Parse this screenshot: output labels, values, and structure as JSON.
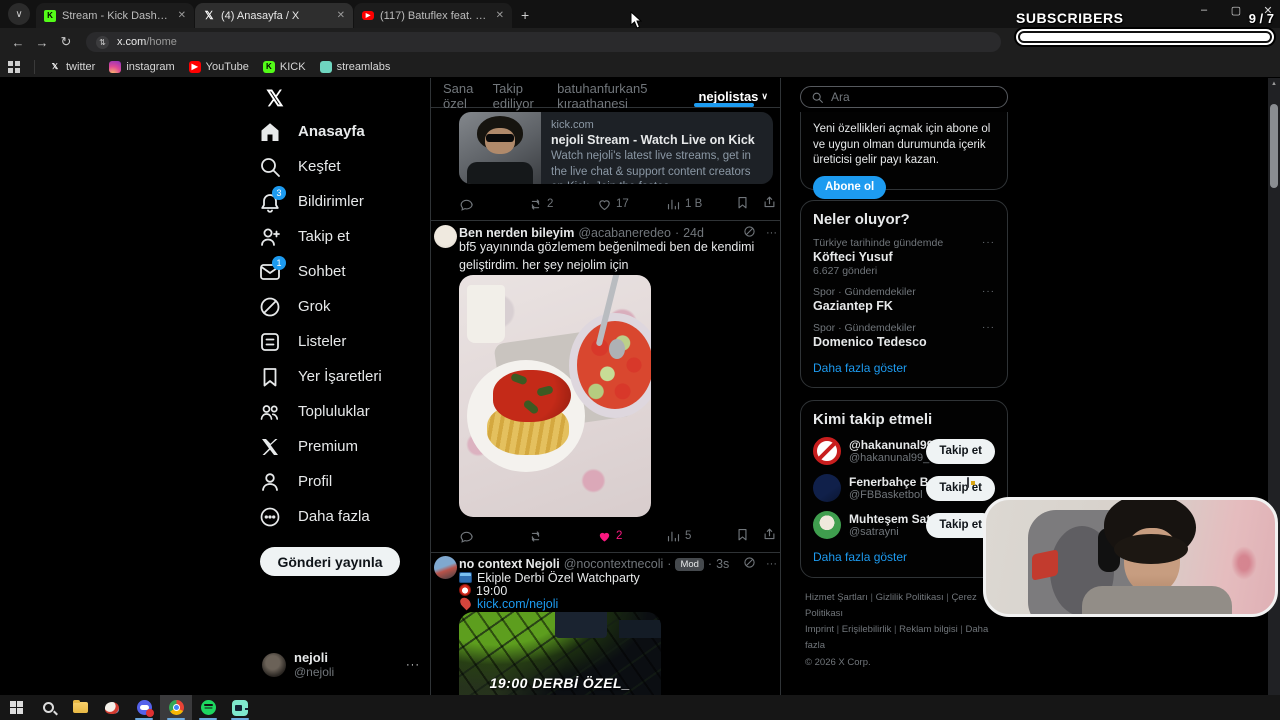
{
  "ui": {
    "sep": "·",
    "close": "✕",
    "plus": "+",
    "more": "···",
    "chevron_down": "∨",
    "back": "←",
    "forward": "→",
    "reload": "↻",
    "minimize": "–",
    "maximize": "▢",
    "scroll_up": "▲"
  },
  "colors": {
    "accent_blue": "#1d9bf0",
    "like_pink": "#f91880",
    "kick_green": "#53fc18",
    "border": "#2f3336"
  },
  "browser": {
    "tabs": [
      {
        "title": "Stream - Kick Dashboard"
      },
      {
        "title": "(4) Anasayfa / X"
      },
      {
        "title": "(117) Batuflex feat. Burak Balka"
      }
    ],
    "url_host": "x.com",
    "url_path": "/home",
    "bookmarks": {
      "b1": "twitter",
      "b2": "instagram",
      "b3": "YouTube",
      "b4": "KICK",
      "b5": "streamlabs"
    }
  },
  "overlay": {
    "subscribers_label": "SUBSCRIBERS",
    "subscribers_count": "9 / 7"
  },
  "sidebar": {
    "items": [
      {
        "label": "Anasayfa"
      },
      {
        "label": "Keşfet"
      },
      {
        "label": "Bildirimler",
        "badge": "3"
      },
      {
        "label": "Takip et"
      },
      {
        "label": "Sohbet",
        "badge": "1"
      },
      {
        "label": "Grok"
      },
      {
        "label": "Listeler"
      },
      {
        "label": "Yer İşaretleri"
      },
      {
        "label": "Topluluklar"
      },
      {
        "label": "Premium"
      },
      {
        "label": "Profil"
      },
      {
        "label": "Daha fazla"
      }
    ],
    "post_button": "Gönderi yayınla",
    "profile": {
      "name": "nejoli",
      "handle": "@nejoli"
    }
  },
  "feed": {
    "tabs": [
      {
        "label": "Sana özel"
      },
      {
        "label": "Takip ediliyor"
      },
      {
        "label": "batuhanfurkan5 kıraathanesi"
      },
      {
        "label": "nejolistas"
      }
    ],
    "tweet1": {
      "card": {
        "domain": "kick.com",
        "title": "nejoli Stream - Watch Live on Kick",
        "description": "Watch nejoli's latest live streams, get in the live chat & support content creators on Kick. Join the fastes..."
      },
      "stats": {
        "reposts": "2",
        "likes": "17",
        "views": "1 B"
      }
    },
    "tweet2": {
      "name": "Ben nerden bileyim",
      "handle": "@acabaneredeo",
      "time": "24d",
      "text": "bf5 yayınında gözlemem beğenilmedi ben de kendimi geliştirdim. her şey nejolim için",
      "stats": {
        "likes": "2",
        "views": "5"
      }
    },
    "tweet3": {
      "name": "no context Nejoli",
      "handle": "@nocontextnecoli",
      "badge": "Mod",
      "time": "3s",
      "line1": "Ekiple Derbi Özel Watchparty",
      "line2": "19:00",
      "line3": "kick.com/nejoli",
      "image_caption": "19:00 DERBİ ÖZEL_"
    }
  },
  "rightbar": {
    "search_placeholder": "Ara",
    "premium": {
      "text": "Yeni özellikleri açmak için abone ol ve uygun olman durumunda içerik üreticisi gelir payı kazan.",
      "button": "Abone ol"
    },
    "trends": {
      "title": "Neler oluyor?",
      "items": [
        {
          "meta": "Türkiye tarihinde gündemde",
          "name": "Köfteci Yusuf",
          "count": "6.627 gönderi"
        },
        {
          "meta": "Spor · Gündemdekiler",
          "name": "Gaziantep FK",
          "count": ""
        },
        {
          "meta": "Spor · Gündemdekiler",
          "name": "Domenico Tedesco",
          "count": ""
        }
      ],
      "show_more": "Daha fazla göster"
    },
    "follow": {
      "title": "Kimi takip etmeli",
      "items": [
        {
          "name": "@hakanunal99_",
          "handle": "@hakanunal99_",
          "button": "Takip et"
        },
        {
          "name": "Fenerbahçe Beko",
          "handle": "@FBBasketbol",
          "button": "Takip et"
        },
        {
          "name": "Muhteşem Satrayni",
          "handle": "@satrayni",
          "button": "Takip et"
        }
      ],
      "show_more": "Daha fazla göster"
    },
    "footer": {
      "l1a": "Hizmet Şartları",
      "l1b": "Gizlilik Politikası",
      "l1c": "Çerez Politikası",
      "l2a": "Imprint",
      "l2b": "Erişilebilirlik",
      "l2c": "Reklam bilgisi",
      "l2d": "Daha fazla",
      "copyright": "© 2026 X Corp."
    }
  }
}
